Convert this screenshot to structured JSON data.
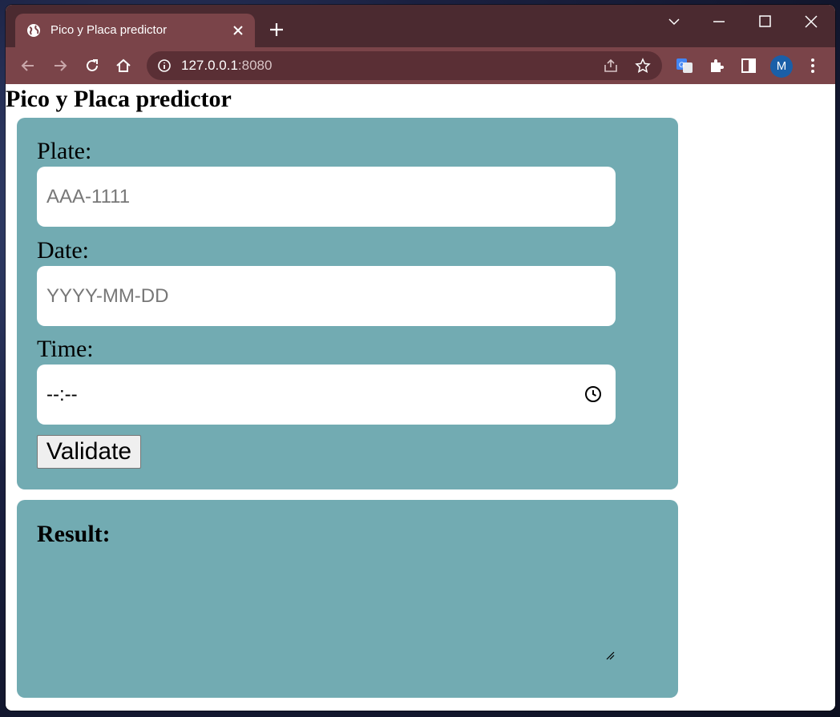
{
  "browser": {
    "tab_title": "Pico y Placa predictor",
    "url_host": "127.0.0.1",
    "url_port": ":8080",
    "profile_initial": "M"
  },
  "page": {
    "title": "Pico y Placa predictor",
    "form": {
      "plate_label": "Plate:",
      "plate_placeholder": "AAA-1111",
      "date_label": "Date:",
      "date_placeholder": "YYYY-MM-DD",
      "time_label": "Time:",
      "time_value": "--:--",
      "validate_label": "Validate"
    },
    "result": {
      "title": "Result:",
      "text": ""
    }
  },
  "colors": {
    "card_bg": "#72abb2",
    "tab_strip": "#4b2a30",
    "toolbar": "#7a4449"
  },
  "icons": [
    "globe-icon",
    "close-icon",
    "plus-icon",
    "chevron-down-icon",
    "minimize-icon",
    "maximize-icon",
    "window-close-icon",
    "back-icon",
    "forward-icon",
    "reload-icon",
    "home-icon",
    "info-icon",
    "share-icon",
    "star-icon",
    "translate-icon",
    "extensions-icon",
    "sidepanel-icon",
    "menu-icon",
    "clock-icon"
  ]
}
